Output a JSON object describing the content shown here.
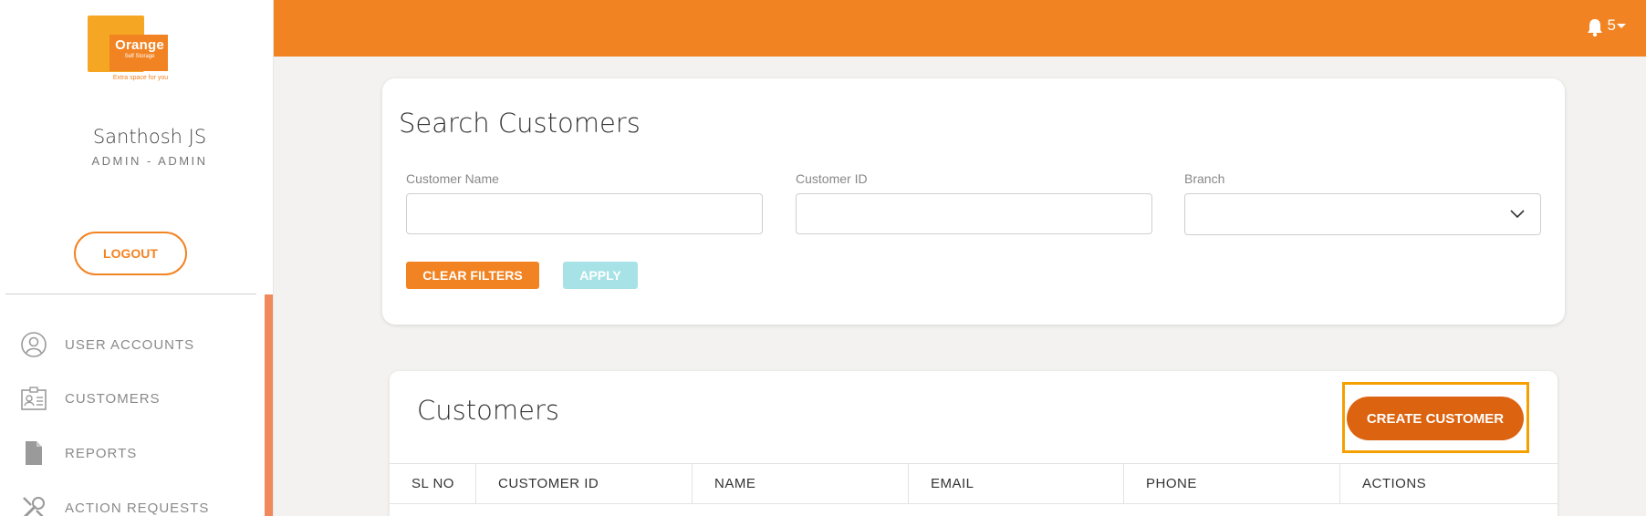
{
  "brand": {
    "logo_text": "Orange",
    "logo_sub": "Self Storage",
    "tagline": "Extra space for you"
  },
  "user": {
    "name": "Santhosh JS",
    "role": "ADMIN - ADMIN"
  },
  "sidebar": {
    "logout_label": "LOGOUT",
    "items": [
      {
        "label": "USER ACCOUNTS",
        "icon": "user-circle-icon"
      },
      {
        "label": "CUSTOMERS",
        "icon": "id-card-icon"
      },
      {
        "label": "REPORTS",
        "icon": "document-icon"
      },
      {
        "label": "ACTION REQUESTS",
        "icon": "tools-icon"
      }
    ]
  },
  "topbar": {
    "notification_count": "5"
  },
  "search": {
    "title": "Search Customers",
    "fields": {
      "customer_name_label": "Customer Name",
      "customer_name_value": "",
      "customer_id_label": "Customer ID",
      "customer_id_value": "",
      "branch_label": "Branch",
      "branch_value": ""
    },
    "clear_label": "CLEAR FILTERS",
    "apply_label": "APPLY"
  },
  "customers": {
    "title": "Customers",
    "create_label": "CREATE CUSTOMER",
    "columns": [
      "SL NO",
      "CUSTOMER ID",
      "NAME",
      "EMAIL",
      "PHONE",
      "ACTIONS"
    ]
  },
  "colors": {
    "accent": "#f28322",
    "create_button": "#dc6310",
    "apply_disabled": "#a7e3e6",
    "highlight": "#f5a000"
  }
}
